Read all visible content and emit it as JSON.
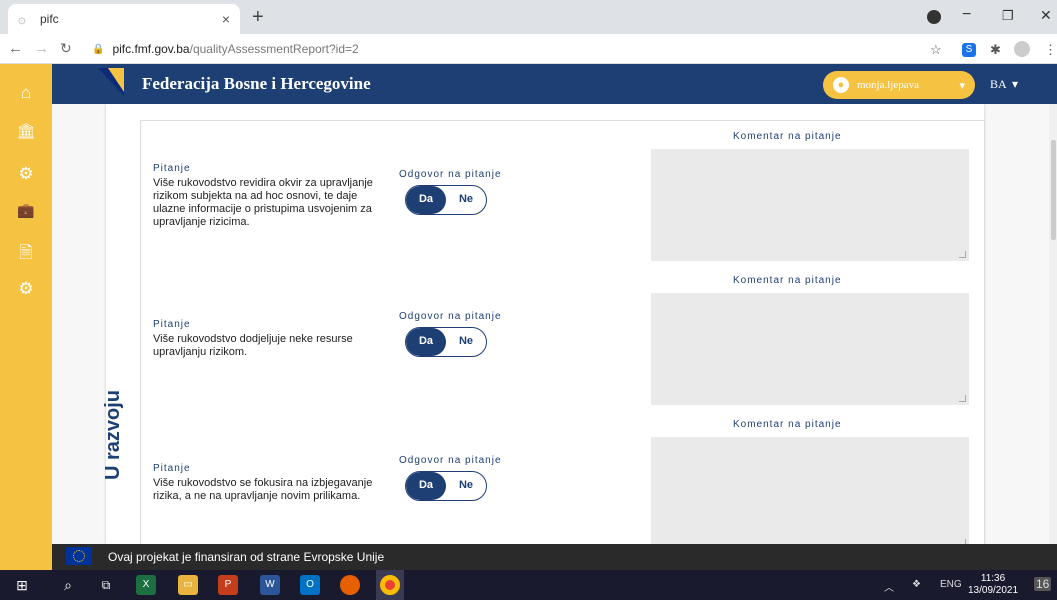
{
  "browser": {
    "tab_title": "pifc",
    "tab_close": "×",
    "new_tab": "+",
    "url_domain": "pifc.fmf.gov.ba",
    "url_path": "/qualityAssessmentReport?id=2",
    "window_controls": [
      "−",
      "❐",
      "✕"
    ]
  },
  "sidebar": {
    "items": [
      {
        "icon": "home-icon",
        "glyph": "⌂"
      },
      {
        "icon": "bank-icon",
        "glyph": "🏛"
      },
      {
        "icon": "settings-shield-icon",
        "glyph": "⚙"
      },
      {
        "icon": "briefcase-icon",
        "glyph": "💼"
      },
      {
        "icon": "document-icon",
        "glyph": "🗎"
      },
      {
        "icon": "gear-icon",
        "glyph": "⚙"
      }
    ]
  },
  "header": {
    "title": "Federacija Bosne i Hercegovine",
    "user_name": "monja.ljepava",
    "language": "BA"
  },
  "main": {
    "state_label": "U razvoju",
    "questions": [
      {
        "label": "Pitanje",
        "text": "Više rukovodstvo revidira okvir za upravljanje rizikom subjekta na ad hoc osnovi, te daje ulazne informacije o pristupima usvojenim za upravljanje rizicima.",
        "answer_label": "Odgovor na pitanje",
        "yes": "Da",
        "no": "Ne",
        "selected": "Da",
        "comment_label": "Komentar na pitanje"
      },
      {
        "label": "Pitanje",
        "text": "Više rukovodstvo dodjeljuje neke resurse upravljanju rizikom.",
        "answer_label": "Odgovor na pitanje",
        "yes": "Da",
        "no": "Ne",
        "selected": "Da",
        "comment_label": "Komentar na pitanje"
      },
      {
        "label": "Pitanje",
        "text": "Više rukovodstvo se fokusira na izbjegavanje rizika, a ne na upravljanje novim prilikama.",
        "answer_label": "Odgovor na pitanje",
        "yes": "Da",
        "no": "Ne",
        "selected": "Da",
        "comment_label": "Komentar na pitanje"
      }
    ]
  },
  "footer": {
    "eu_text": "Ovaj projekat je finansiran od strane Evropske Unije"
  },
  "taskbar": {
    "lang": "ENG",
    "time": "11:36",
    "date": "13/09/2021",
    "notifications": "16"
  },
  "colors": {
    "primary": "#1e3f74",
    "accent": "#f5c242"
  }
}
